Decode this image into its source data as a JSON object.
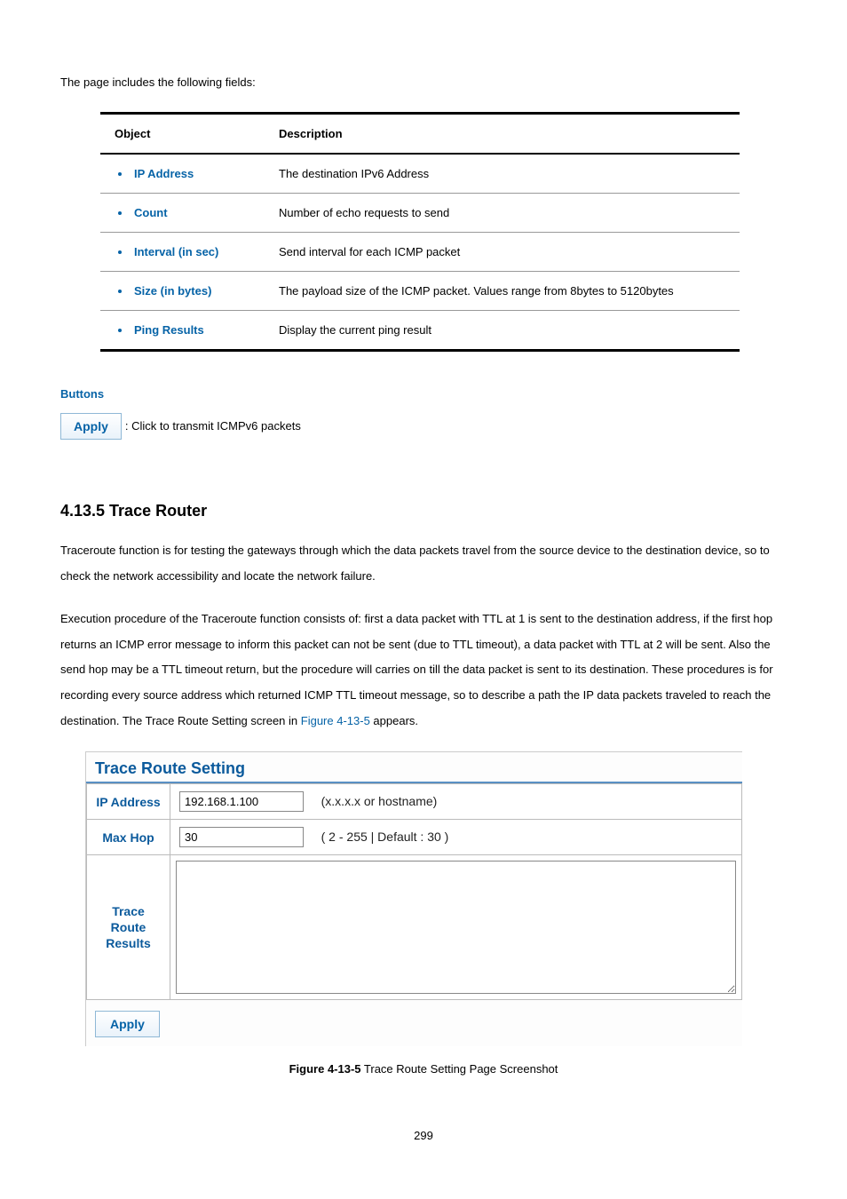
{
  "intro": "The page includes the following fields:",
  "table": {
    "headers": {
      "object": "Object",
      "description": "Description"
    },
    "rows": [
      {
        "object": "IP Address",
        "description": "The destination IPv6 Address"
      },
      {
        "object": "Count",
        "description": "Number of echo requests to send"
      },
      {
        "object": "Interval (in sec)",
        "description": "Send interval for each ICMP packet"
      },
      {
        "object": "Size (in bytes)",
        "description": "The payload size of the ICMP packet. Values range from 8bytes to 5120bytes"
      },
      {
        "object": "Ping Results",
        "description": "Display the current ping result"
      }
    ]
  },
  "buttons": {
    "heading": "Buttons",
    "apply_label": "Apply",
    "apply_desc": ": Click to transmit ICMPv6 packets"
  },
  "section": {
    "title": "4.13.5 Trace Router",
    "p1": "Traceroute function is for testing the gateways through which the data packets travel from the source device to the destination device, so to check the network accessibility and locate the network failure.",
    "p2a": "Execution procedure of the Traceroute function consists of: first a data packet with TTL at 1 is sent to the destination address, if the first hop returns an ICMP error message to inform this packet can not be sent (due to TTL timeout), a data packet with TTL at 2 will be sent. Also the send hop may be a TTL timeout return, but the procedure will carries on till the data packet is sent to its destination. These procedures is for recording every source address which returned ICMP TTL timeout message, so to describe a path the IP data packets traveled to reach the destination. The Trace Route Setting screen in ",
    "p2_link": "Figure 4-13-5",
    "p2b": " appears."
  },
  "screenshot": {
    "panel_title": "Trace Route Setting",
    "rows": {
      "ip": {
        "label": "IP Address",
        "value": "192.168.1.100",
        "hint": "(x.x.x.x or hostname)"
      },
      "maxhop": {
        "label": "Max Hop",
        "value": "30",
        "hint": "( 2 - 255 | Default : 30 )"
      },
      "results": {
        "label": "Trace Route Results",
        "value": ""
      }
    },
    "apply_label": "Apply"
  },
  "caption": {
    "bold": "Figure 4-13-5",
    "rest": " Trace Route Setting Page Screenshot"
  },
  "pagenum": "299"
}
